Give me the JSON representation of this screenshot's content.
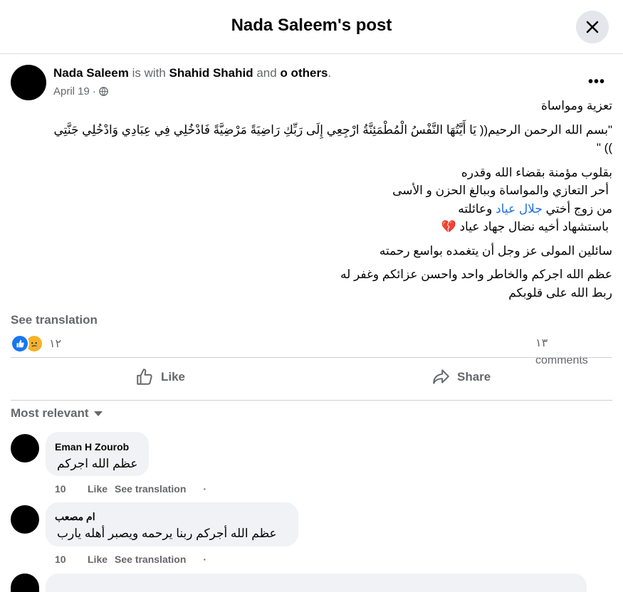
{
  "header": {
    "title": "Nada Saleem's post"
  },
  "post": {
    "author": "Nada Saleem",
    "with_text": "is with",
    "tagged": "Shahid Shahid",
    "and_text": "and",
    "others": "o others",
    "period": ".",
    "date": "April 19",
    "more": "•••",
    "lines": {
      "l1": "تعزية ومواساة",
      "l2": "\"بسم الله الرحمن الرحيم(( يَا أَيَّتُهَا النَّفْسُ الْمُطْمَئِنَّةُ ارْجِعِي إِلَى رَبِّكِ رَاضِيَةً مَرْضِيَّةً فَادْخُلِي فِي عِبَادِي وَادْخُلِي جَنَّتِي",
      "l3": "))  \"",
      "l4": "بقلوب مؤمنة بقضاء الله وقدره",
      "l5": "أحر التعازي والمواساة وببالغ الحزن و الأسى",
      "l6_prefix": "من زوج أختي",
      "l6_link": "جلال عياد",
      "l6_suffix": "وعائلته",
      "l7": "باستشهاد أخيه نضال جهاد عياد",
      "l7_emoji": "💔",
      "l8": "سائلين المولى عز وجل أن يتغمده بواسع رحمته",
      "l9": "عظم الله اجركم والخاطر واحد واحسن عزائكم وغفر له",
      "l10": "ربط الله على قلوبكم"
    },
    "see_translation": "See translation",
    "reaction_count": "١٢",
    "comments_count": "١٣ comments",
    "actions": {
      "like": "Like",
      "share": "Share"
    }
  },
  "sort": {
    "label": "Most relevant"
  },
  "comments": [
    {
      "name": "Eman H Zourob",
      "text": "عظم الله اجركم",
      "time": "10",
      "like": "Like",
      "translate": "See translation",
      "dot": "·"
    },
    {
      "name": "ام مصعب",
      "text": "عظم الله أجركم ربنا يرحمه ويصبر أهله يارب",
      "time": "10",
      "like": "Like",
      "translate": "See translation",
      "dot": "·"
    }
  ]
}
